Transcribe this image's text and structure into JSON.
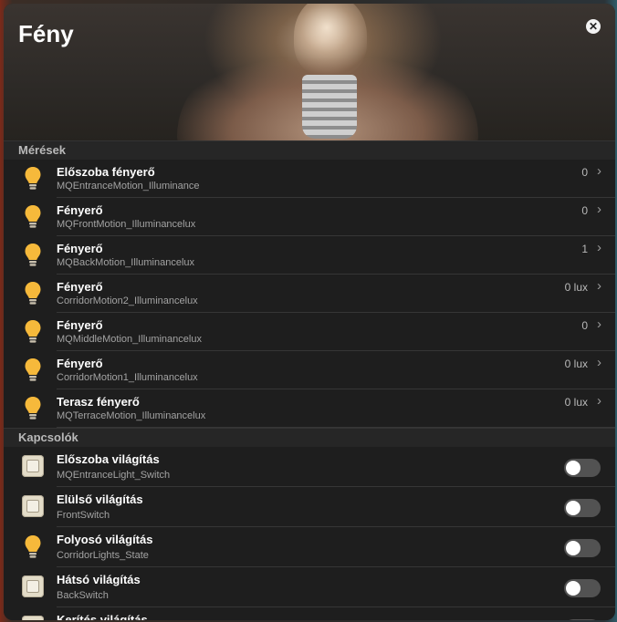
{
  "dialog": {
    "title": "Fény",
    "close_icon": "close-icon",
    "close_glyph": "✕"
  },
  "sections": {
    "measurements": "Mérések",
    "switches": "Kapcsolók"
  },
  "measurements": [
    {
      "title": "Előszoba fényerő",
      "entity": "MQEntranceMotion_Illuminance",
      "value": "0",
      "icon": "lightbulb-icon"
    },
    {
      "title": "Fényerő",
      "entity": "MQFrontMotion_Illuminancelux",
      "value": "0",
      "icon": "lightbulb-icon"
    },
    {
      "title": "Fényerő",
      "entity": "MQBackMotion_Illuminancelux",
      "value": "1",
      "icon": "lightbulb-icon"
    },
    {
      "title": "Fényerő",
      "entity": "CorridorMotion2_Illuminancelux",
      "value": "0 lux",
      "icon": "lightbulb-icon"
    },
    {
      "title": "Fényerő",
      "entity": "MQMiddleMotion_Illuminancelux",
      "value": "0",
      "icon": "lightbulb-icon"
    },
    {
      "title": "Fényerő",
      "entity": "CorridorMotion1_Illuminancelux",
      "value": "0 lux",
      "icon": "lightbulb-icon"
    },
    {
      "title": "Terasz fényerő",
      "entity": "MQTerraceMotion_Illuminancelux",
      "value": "0 lux",
      "icon": "lightbulb-icon"
    }
  ],
  "switches": [
    {
      "title": "Előszoba világítás",
      "entity": "MQEntranceLight_Switch",
      "on": false,
      "icon": "wall-switch-icon"
    },
    {
      "title": "Elülső világítás",
      "entity": "FrontSwitch",
      "on": false,
      "icon": "wall-switch-icon"
    },
    {
      "title": "Folyosó világítás",
      "entity": "CorridorLights_State",
      "on": false,
      "icon": "lightbulb-icon"
    },
    {
      "title": "Hátsó világítás",
      "entity": "BackSwitch",
      "on": false,
      "icon": "wall-switch-icon"
    },
    {
      "title": "Kerítés világítás",
      "entity": "",
      "on": false,
      "icon": "wall-switch-icon"
    }
  ],
  "colors": {
    "bulb": "#f6b93b",
    "bulb_base": "#c9c0ad",
    "panel_bg": "#1c1c1c",
    "toggle_off": "#525252"
  },
  "chevron_glyph": "›"
}
